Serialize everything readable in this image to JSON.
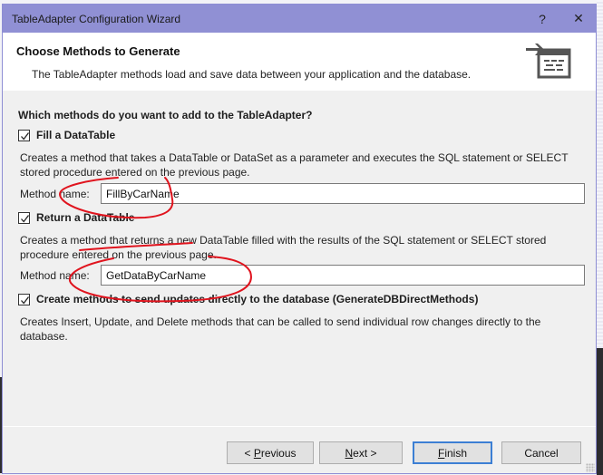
{
  "window": {
    "title": "TableAdapter Configuration Wizard",
    "help_glyph": "?",
    "close_glyph": "✕"
  },
  "header": {
    "title": "Choose Methods to Generate",
    "subtitle": "The TableAdapter methods load and save data between your application and the database.",
    "icon": "wizard-table-icon"
  },
  "body": {
    "question": "Which methods do you want to add to the TableAdapter?",
    "options": [
      {
        "label": "Fill a DataTable",
        "checked": true,
        "description": "Creates a method that takes a DataTable or DataSet as a parameter and executes the SQL statement or SELECT stored procedure entered on the previous page.",
        "method_label": "Method name:",
        "method_value": "FillByCarName"
      },
      {
        "label": "Return a DataTable",
        "checked": true,
        "description": "Creates a method that returns a new DataTable filled with the results of the SQL statement or SELECT stored procedure entered on the previous page.",
        "method_label": "Method name:",
        "method_value": "GetDataByCarName"
      },
      {
        "label": "Create methods to send updates directly to the database (GenerateDBDirectMethods)",
        "checked": true,
        "description": "Creates Insert, Update, and Delete methods that can be called to send individual row changes directly to the database."
      }
    ]
  },
  "footer": {
    "previous": {
      "prefix": "< ",
      "mnemonic": "P",
      "rest": "revious"
    },
    "next": {
      "prefix": "",
      "mnemonic": "N",
      "rest": "ext >"
    },
    "finish": {
      "prefix": "",
      "mnemonic": "F",
      "rest": "inish"
    },
    "cancel": "Cancel"
  },
  "annotation_color": "#e0141e",
  "focus_color": "#3c7fd4"
}
